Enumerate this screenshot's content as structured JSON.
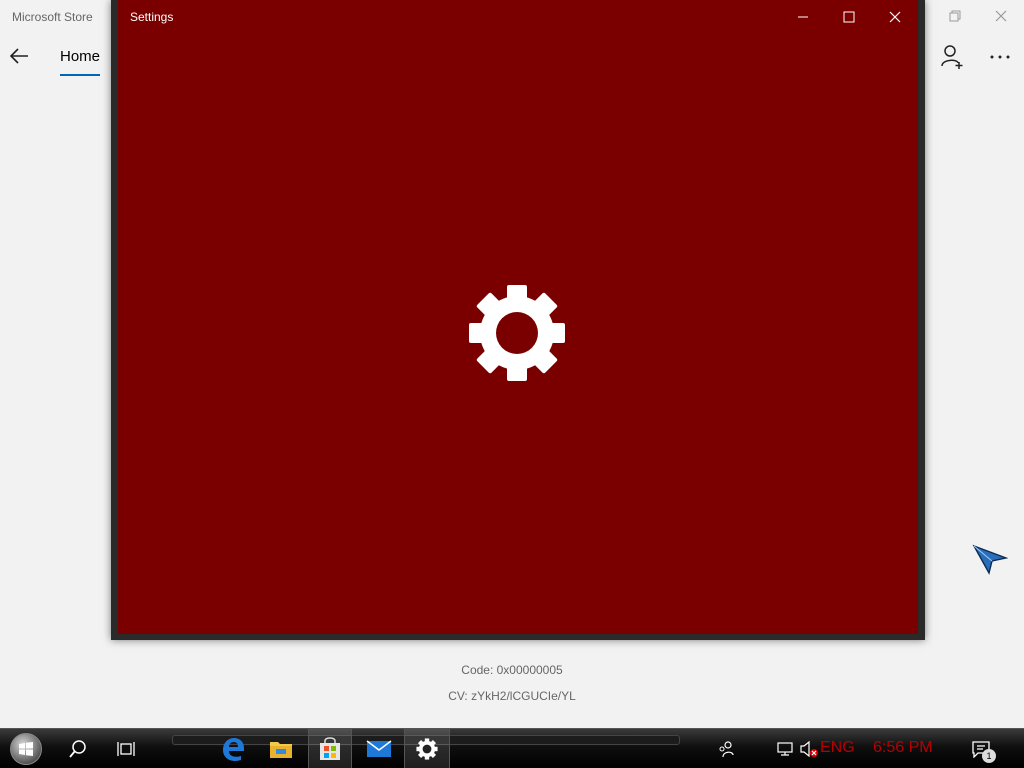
{
  "store": {
    "title": "Microsoft Store",
    "nav": {
      "home_label": "Home"
    },
    "error": {
      "code": "Code: 0x00000005",
      "cv": "CV: zYkH2/lCGUCIe/YL"
    }
  },
  "settings_window": {
    "title": "Settings",
    "splash_color": "#7a0000",
    "splash_icon": "gear-icon"
  },
  "taskbar": {
    "apps": [
      "edge-icon",
      "file-explorer-icon",
      "store-icon",
      "mail-icon",
      "settings-icon"
    ],
    "active_app": "settings-icon",
    "tray": {
      "language": "ENG",
      "time": "6:56 PM",
      "notification_count": "1"
    }
  },
  "colors": {
    "accent": "#0067b8",
    "tray_text": "#b80000"
  }
}
